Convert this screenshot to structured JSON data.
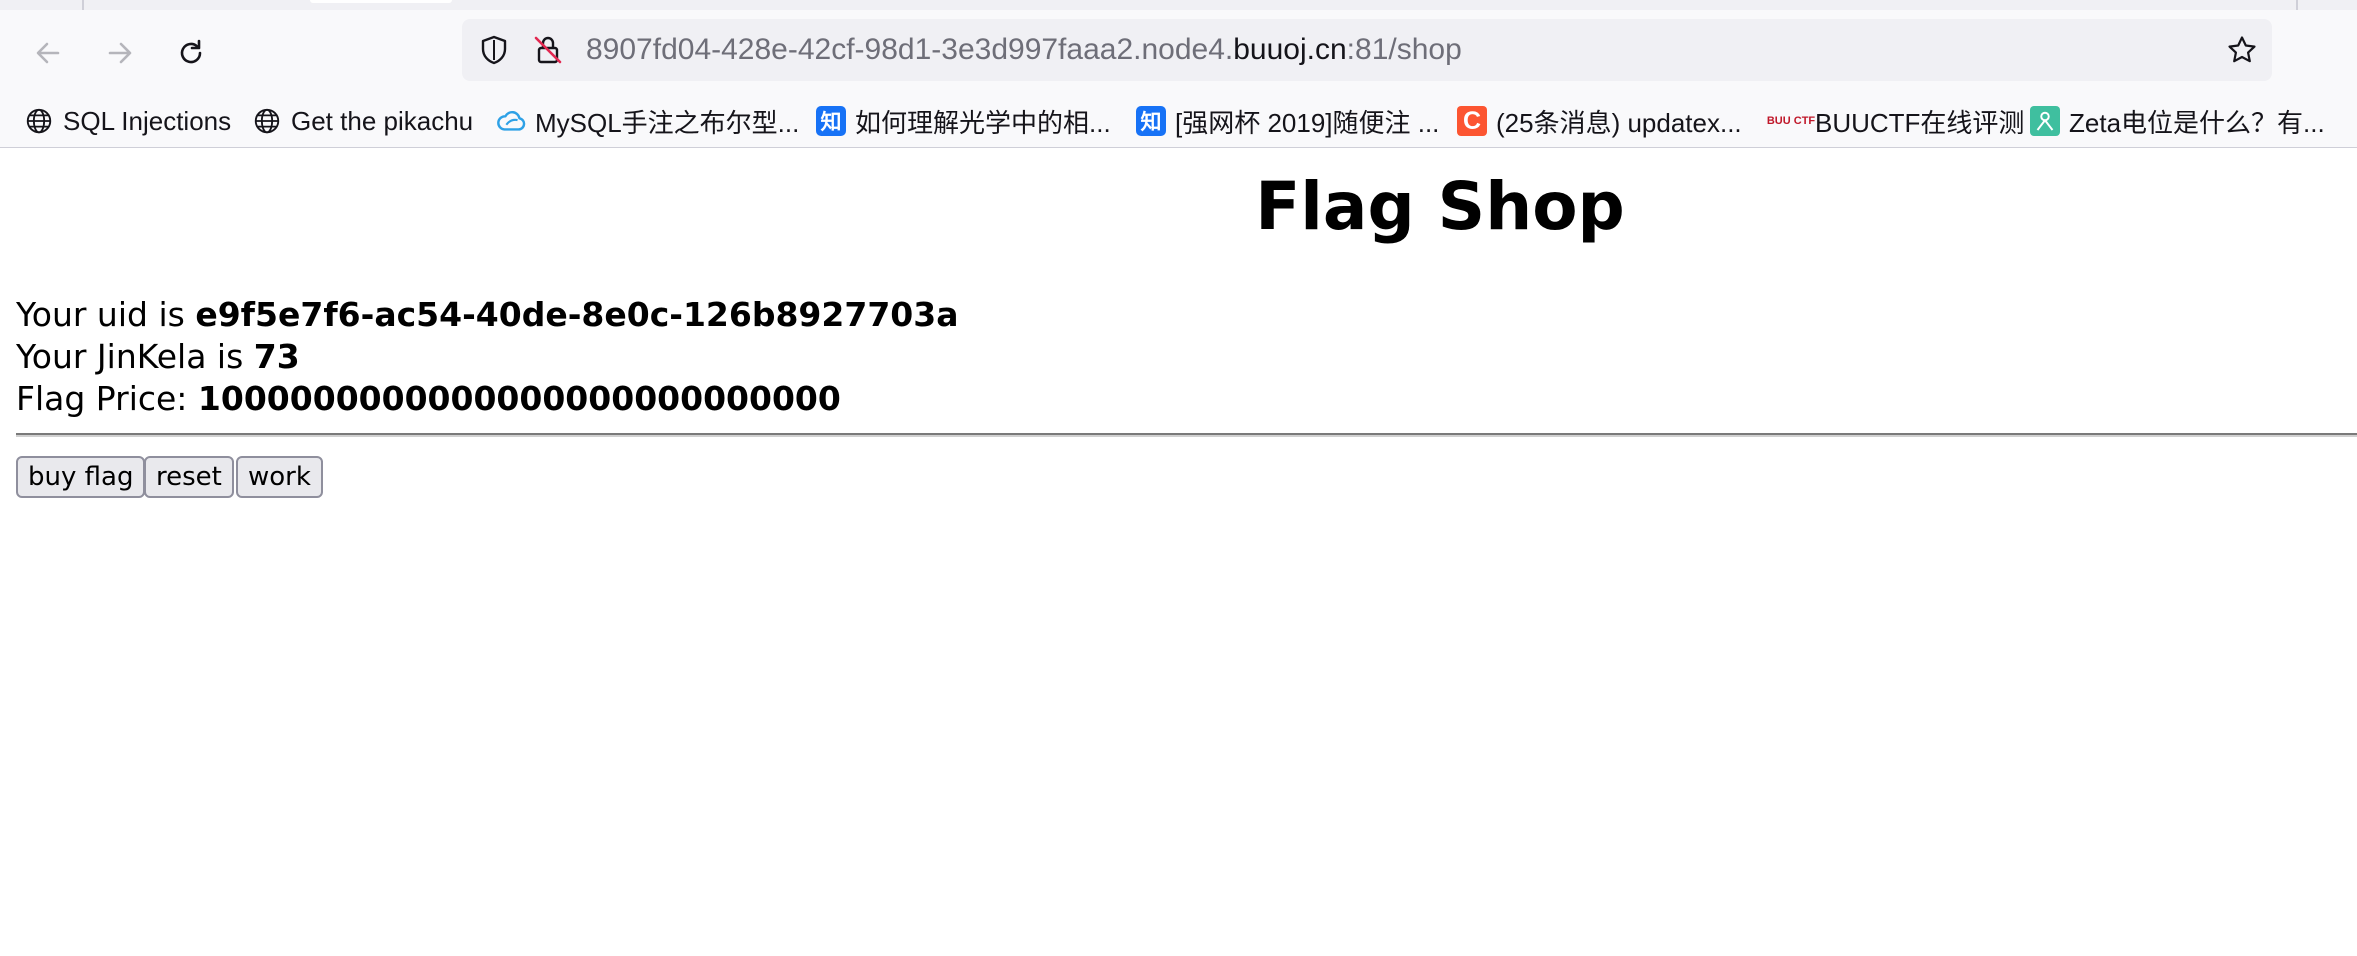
{
  "browser": {
    "address_bar": {
      "url_prefix": "8907fd04-428e-42cf-98d1-3e3d997faaa2.node4.",
      "url_host": "buuoj.cn",
      "url_suffix": ":81/shop"
    },
    "icons": {
      "back": "back-arrow-icon",
      "forward": "forward-arrow-icon",
      "reload": "reload-icon",
      "tracking_protection": "shield-icon",
      "insecure_connection": "lock-strikethrough-icon",
      "bookmark": "star-icon"
    },
    "bookmarks": [
      {
        "label": "SQL Injections",
        "icon": "globe-icon"
      },
      {
        "label": "Get the pikachu",
        "icon": "globe-icon"
      },
      {
        "label": "MySQL手注之布尔型...",
        "icon": "cloud-icon"
      },
      {
        "label": "如何理解光学中的相...",
        "icon": "zhihu-icon",
        "icon_text": "知"
      },
      {
        "label": "[强网杯 2019]随便注 ...",
        "icon": "zhihu-icon",
        "icon_text": "知"
      },
      {
        "label": "(25条消息) updatex...",
        "icon": "csdn-icon",
        "icon_text": "C"
      },
      {
        "label": "BUUCTF在线评测",
        "icon": "buuctf-icon",
        "icon_text": "BUU CTF"
      },
      {
        "label": "Zeta电位是什么？有...",
        "icon": "zeta-icon"
      }
    ]
  },
  "page": {
    "title": "Flag Shop",
    "uid_label": "Your uid is ",
    "uid_value": "e9f5e7f6-ac54-40de-8e0c-126b8927703a",
    "jinkela_label": "Your JinKela is ",
    "jinkela_value": "73",
    "price_label": "Flag Price: ",
    "price_value": "1000000000000000000000000000",
    "buttons": {
      "buy_flag": "buy flag",
      "reset": "reset",
      "work": "work"
    }
  },
  "colors": {
    "chrome_bg": "#f9f9fb",
    "urlbar_bg": "#f0f0f4",
    "zhihu_blue": "#1772f6",
    "csdn_red": "#fc5531",
    "button_bg": "#e9e9ed"
  }
}
